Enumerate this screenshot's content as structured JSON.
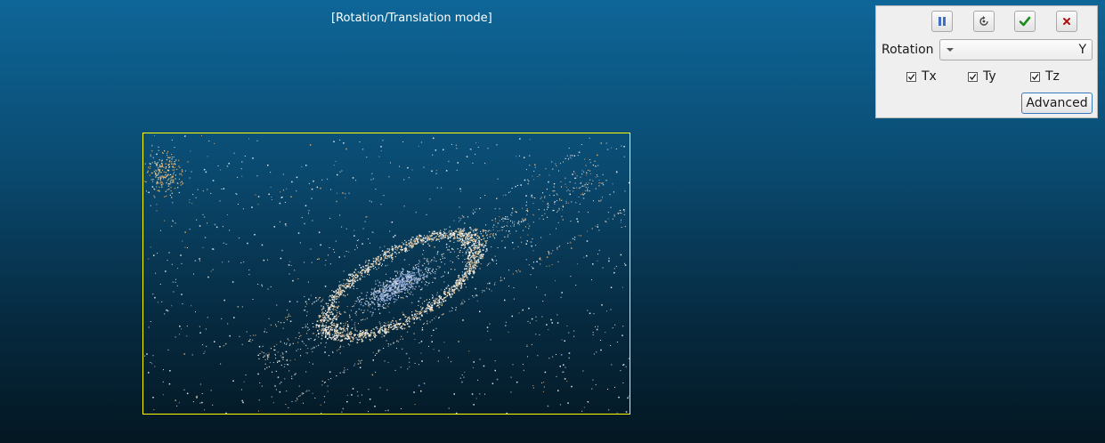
{
  "viewport": {
    "mode_label": "[Rotation/Translation mode]",
    "bbox_color": "#ffff00"
  },
  "panel": {
    "buttons": [
      {
        "name": "pause-button",
        "icon": "pause-icon"
      },
      {
        "name": "reset-button",
        "icon": "reset-icon"
      },
      {
        "name": "apply-button",
        "icon": "check-icon",
        "color": "#1e8c1e"
      },
      {
        "name": "cancel-button",
        "icon": "close-icon",
        "color": "#b01010"
      }
    ],
    "rotation_label": "Rotation",
    "rotation_value": "Y",
    "translations": [
      {
        "label": "Tx",
        "checked": true
      },
      {
        "label": "Ty",
        "checked": true
      },
      {
        "label": "Tz",
        "checked": true
      }
    ],
    "advanced_label": "Advanced"
  }
}
